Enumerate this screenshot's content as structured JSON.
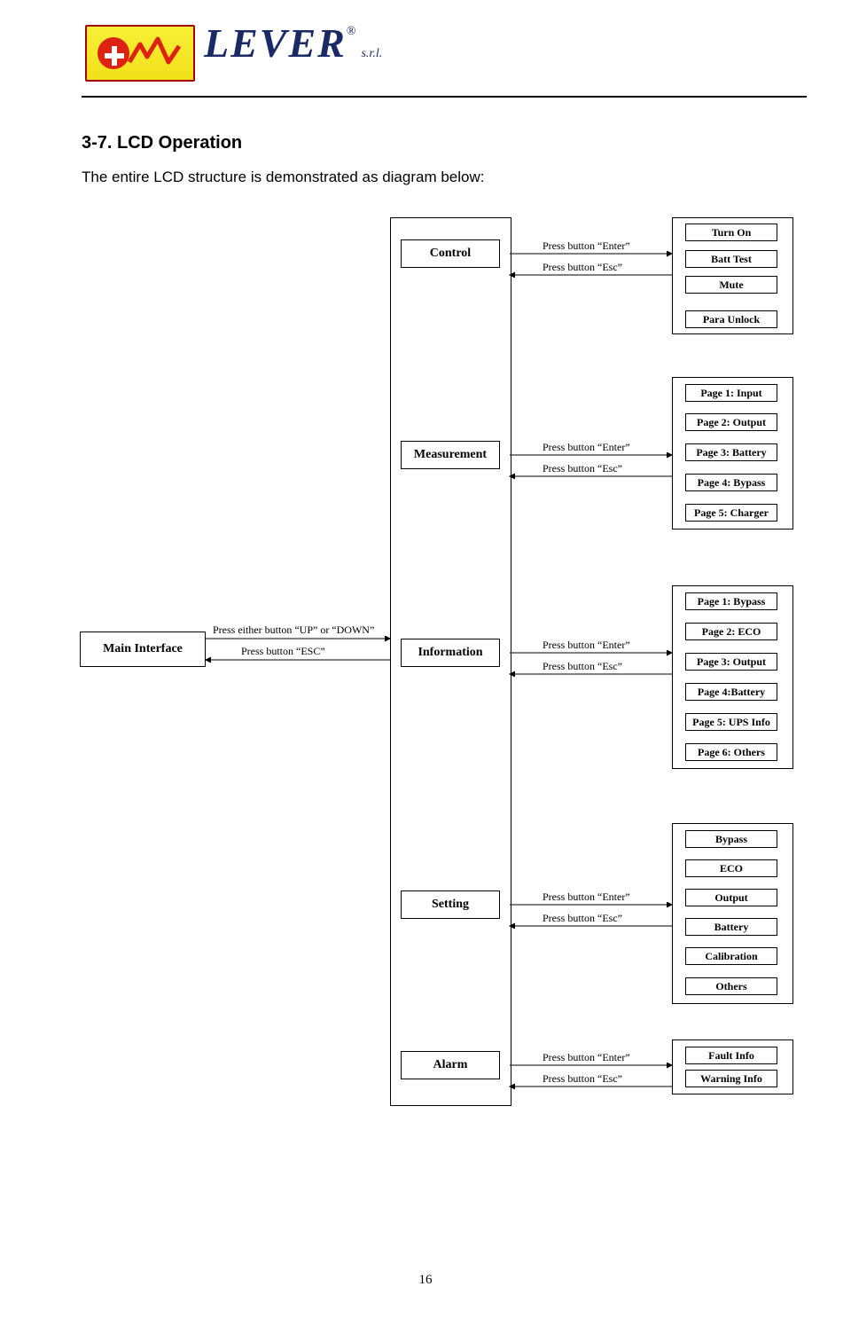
{
  "logo": {
    "brand": "LEVER",
    "reg": "®",
    "suffix": "s.r.l."
  },
  "heading": "3-7. LCD Operation",
  "intro": "The entire LCD structure is demonstrated as diagram below:",
  "mainInterface": "Main Interface",
  "mainLink": {
    "forward": "Press either button “UP” or “DOWN”",
    "back": "Press  button “ESC”"
  },
  "menus": {
    "control": "Control",
    "measurement": "Measurement",
    "information": "Information",
    "setting": "Setting",
    "alarm": "Alarm"
  },
  "link": {
    "enter": "Press button “Enter”",
    "esc": "Press button “Esc”"
  },
  "controlItems": {
    "turnOn": "Turn On",
    "battTest": "Batt Test",
    "mute": "Mute",
    "paraUnlock": "Para Unlock"
  },
  "measurementItems": {
    "p1": "Page 1: Input",
    "p2": "Page 2: Output",
    "p3": "Page 3: Battery",
    "p4": "Page 4: Bypass",
    "p5": "Page 5: Charger"
  },
  "informationItems": {
    "p1": "Page 1: Bypass",
    "p2": "Page 2:  ECO",
    "p3": "Page 3: Output",
    "p4": "Page 4:Battery",
    "p5": "Page 5: UPS Info",
    "p6": "Page 6: Others"
  },
  "settingItems": {
    "bypass": "Bypass",
    "eco": "ECO",
    "output": "Output",
    "battery": "Battery",
    "calibration": "Calibration",
    "others": "Others"
  },
  "alarmItems": {
    "fault": "Fault Info",
    "warning": "Warning Info"
  },
  "pageNumber": "16"
}
